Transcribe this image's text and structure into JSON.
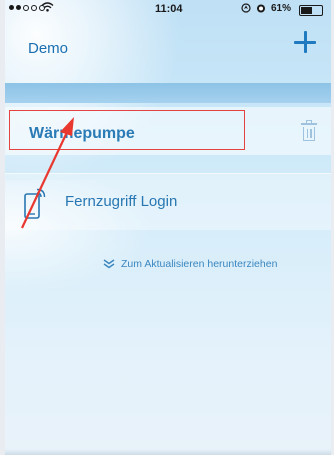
{
  "status_bar": {
    "carrier_signal": "●●○○○",
    "time": "11:04",
    "battery_percent": "61%",
    "battery_level": 0.61,
    "icons": [
      "wifi-icon",
      "location-icon",
      "alarm-icon",
      "battery-icon"
    ]
  },
  "navbar": {
    "title": "Demo",
    "add_icon": "plus-icon"
  },
  "devices": [
    {
      "label": "Wärmepumpe",
      "delete_icon": "trash-icon"
    }
  ],
  "remote_access": {
    "label": "Fernzugriff Login",
    "icon": "phone-wireless-icon"
  },
  "pull_hint": {
    "label": "Zum Aktualisieren herunterziehen",
    "icon": "double-chevron-down-icon"
  },
  "colors": {
    "accent": "#1f7ac0",
    "highlight_box": "#e5433f",
    "annotation_arrow": "#e8382f"
  }
}
